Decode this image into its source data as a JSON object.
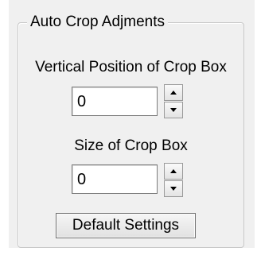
{
  "group": {
    "title": "Auto Crop Adjments"
  },
  "vertical_position": {
    "label": "Vertical Position of Crop Box",
    "value": "0"
  },
  "size": {
    "label": "Size of Crop Box",
    "value": "0"
  },
  "buttons": {
    "default_settings": "Default Settings"
  },
  "icons": {
    "spin_up": "triangle-up-icon",
    "spin_down": "triangle-down-icon"
  },
  "colors": {
    "panel_bg": "#f0f0f0",
    "group_border": "#c8c8c8",
    "input_border": "#7a7a7a"
  }
}
